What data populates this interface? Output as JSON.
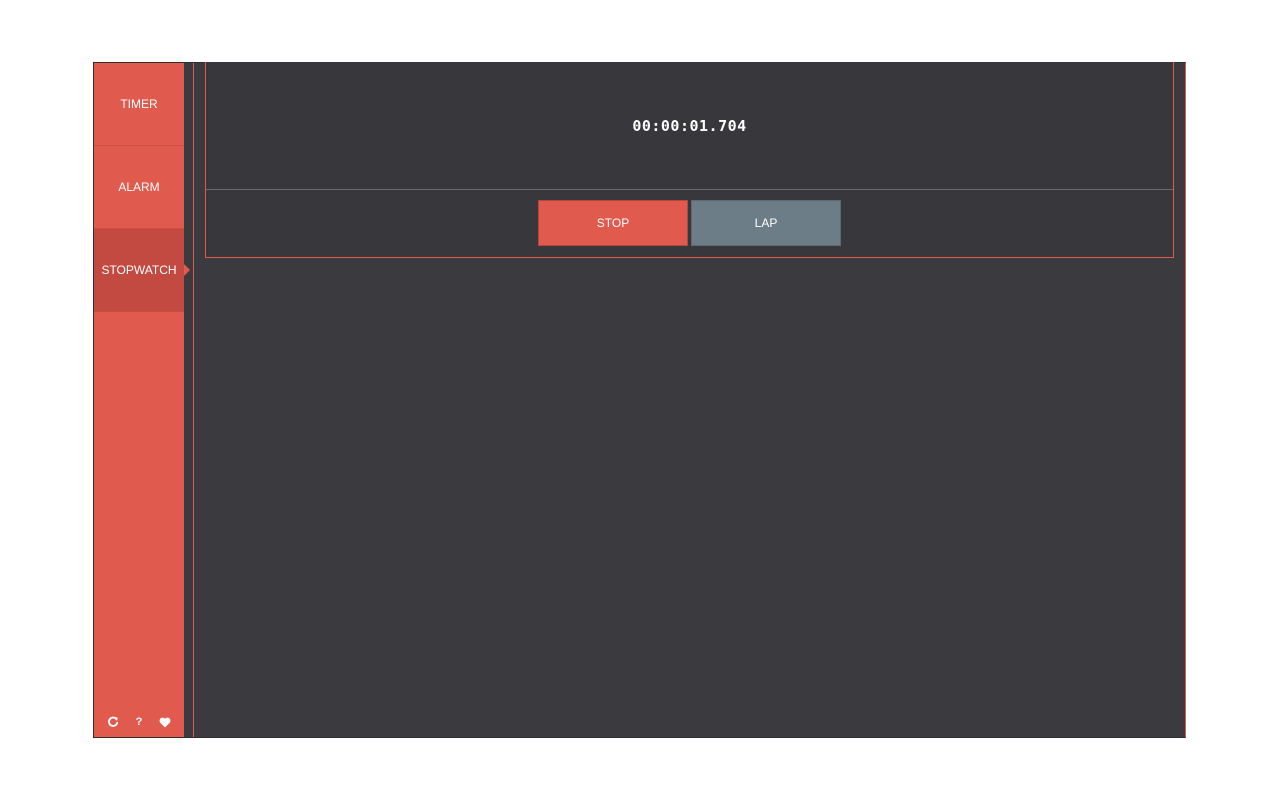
{
  "sidebar": {
    "items": [
      {
        "label": "TIMER",
        "active": false
      },
      {
        "label": "ALARM",
        "active": false
      },
      {
        "label": "STOPWATCH",
        "active": true
      }
    ],
    "footer_icons": [
      "refresh-icon",
      "help-icon",
      "heart-icon"
    ]
  },
  "stopwatch": {
    "time": "00:00:01.704",
    "stop_label": "STOP",
    "lap_label": "LAP"
  },
  "colors": {
    "accent": "#e05a4e",
    "accent_active": "#c24a40",
    "background": "#3b3a3f",
    "lap_button": "#6d7d87"
  }
}
